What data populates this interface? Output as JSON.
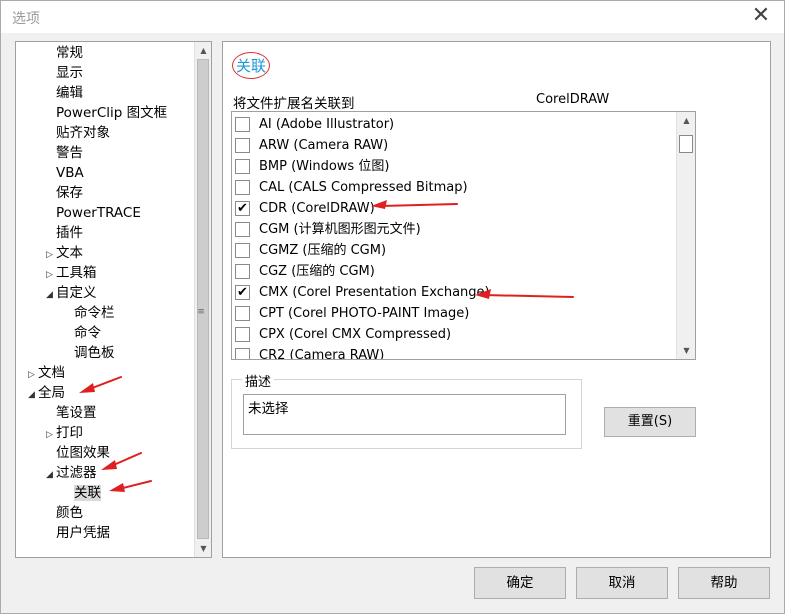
{
  "window": {
    "title": "选项",
    "close_glyph": "✕"
  },
  "tree": {
    "items": [
      {
        "label": "常规",
        "expander": ""
      },
      {
        "label": "显示",
        "expander": ""
      },
      {
        "label": "编辑",
        "expander": ""
      },
      {
        "label": "PowerClip 图文框",
        "expander": ""
      },
      {
        "label": "贴齐对象",
        "expander": ""
      },
      {
        "label": "警告",
        "expander": ""
      },
      {
        "label": "VBA",
        "expander": ""
      },
      {
        "label": "保存",
        "expander": ""
      },
      {
        "label": "PowerTRACE",
        "expander": ""
      },
      {
        "label": "插件",
        "expander": ""
      },
      {
        "label": "文本",
        "expander": "▷"
      },
      {
        "label": "工具箱",
        "expander": "▷"
      },
      {
        "label": "自定义",
        "expander": "◢"
      },
      {
        "label": "命令栏",
        "expander": ""
      },
      {
        "label": "命令",
        "expander": ""
      },
      {
        "label": "调色板",
        "expander": ""
      },
      {
        "label": "文档",
        "expander": "▷"
      },
      {
        "label": "全局",
        "expander": "◢"
      },
      {
        "label": "笔设置",
        "expander": ""
      },
      {
        "label": "打印",
        "expander": "▷"
      },
      {
        "label": "位图效果",
        "expander": ""
      },
      {
        "label": "过滤器",
        "expander": "◢"
      },
      {
        "label": "关联",
        "expander": "",
        "selected": true
      },
      {
        "label": "颜色",
        "expander": ""
      },
      {
        "label": "用户凭据",
        "expander": ""
      }
    ]
  },
  "panel": {
    "section_title": "关联",
    "header_left": "将文件扩展名关联到",
    "header_right": "CorelDRAW",
    "file_types": [
      {
        "label": "AI  (Adobe Illustrator)",
        "checked": false
      },
      {
        "label": "ARW  (Camera RAW)",
        "checked": false
      },
      {
        "label": "BMP  (Windows 位图)",
        "checked": false
      },
      {
        "label": "CAL  (CALS Compressed Bitmap)",
        "checked": false
      },
      {
        "label": "CDR  (CorelDRAW)",
        "checked": true
      },
      {
        "label": "CGM  (计算机图形图元文件)",
        "checked": false
      },
      {
        "label": "CGMZ  (压缩的 CGM)",
        "checked": false
      },
      {
        "label": "CGZ  (压缩的 CGM)",
        "checked": false
      },
      {
        "label": "CMX  (Corel Presentation Exchange)",
        "checked": true
      },
      {
        "label": "CPT  (Corel PHOTO-PAINT Image)",
        "checked": false
      },
      {
        "label": "CPX  (Corel CMX Compressed)",
        "checked": false
      },
      {
        "label": "CR2  (Camera RAW)",
        "checked": false
      }
    ],
    "description_label": "描述",
    "description_value": "未选择",
    "reset_button": "重置(S)"
  },
  "footer": {
    "ok": "确定",
    "cancel": "取消",
    "help": "帮助"
  },
  "colors": {
    "accent": "#1c9ad6",
    "annotation_red": "#e02020"
  }
}
